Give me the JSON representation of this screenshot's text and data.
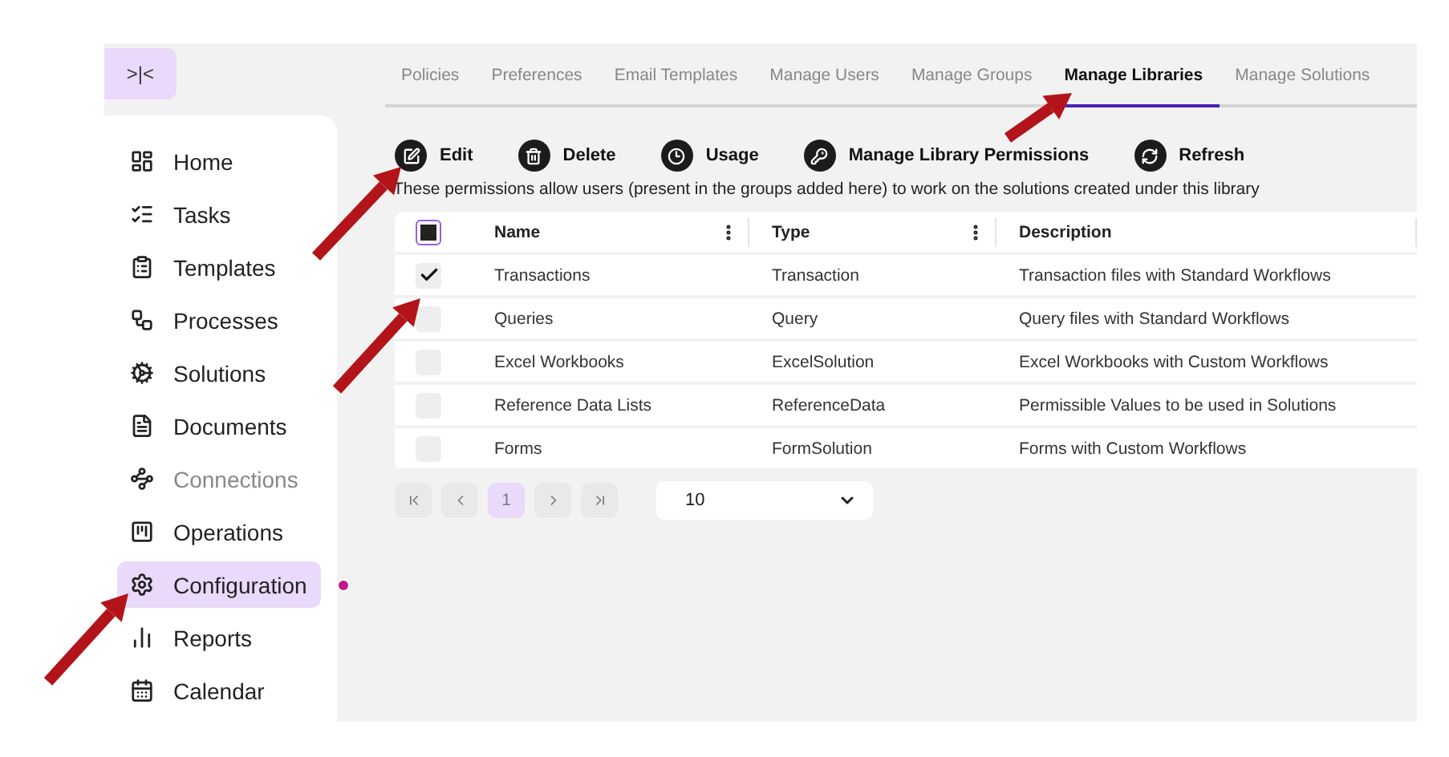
{
  "sidebar": {
    "toggle": ">|<",
    "items": [
      {
        "label": "Home",
        "selected": false,
        "disabled": false
      },
      {
        "label": "Tasks",
        "selected": false,
        "disabled": false
      },
      {
        "label": "Templates",
        "selected": false,
        "disabled": false
      },
      {
        "label": "Processes",
        "selected": false,
        "disabled": false
      },
      {
        "label": "Solutions",
        "selected": false,
        "disabled": false
      },
      {
        "label": "Documents",
        "selected": false,
        "disabled": false
      },
      {
        "label": "Connections",
        "selected": false,
        "disabled": true
      },
      {
        "label": "Operations",
        "selected": false,
        "disabled": false
      },
      {
        "label": "Configuration",
        "selected": true,
        "disabled": false
      },
      {
        "label": "Reports",
        "selected": false,
        "disabled": false
      },
      {
        "label": "Calendar",
        "selected": false,
        "disabled": false
      }
    ]
  },
  "tabs": [
    {
      "label": "Policies",
      "selected": false
    },
    {
      "label": "Preferences",
      "selected": false
    },
    {
      "label": "Email Templates",
      "selected": false
    },
    {
      "label": "Manage Users",
      "selected": false
    },
    {
      "label": "Manage Groups",
      "selected": false
    },
    {
      "label": "Manage Libraries",
      "selected": true
    },
    {
      "label": "Manage Solutions",
      "selected": false
    }
  ],
  "toolbar": [
    "Edit",
    "Delete",
    "Usage",
    "Manage Library Permissions",
    "Refresh"
  ],
  "description": "These permissions allow users (present in the groups added here) to work on the solutions created under this library",
  "table": {
    "all_checked": false,
    "columns": [
      "Name",
      "Type",
      "Description"
    ],
    "rows": [
      {
        "checked": true,
        "cells": [
          "Transactions",
          "Transaction",
          "Transaction files with Standard Workflows"
        ]
      },
      {
        "checked": false,
        "cells": [
          "Queries",
          "Query",
          "Query files with Standard Workflows"
        ]
      },
      {
        "checked": false,
        "cells": [
          "Excel Workbooks",
          "ExcelSolution",
          "Excel Workbooks with Custom Workflows"
        ]
      },
      {
        "checked": false,
        "cells": [
          "Reference Data Lists",
          "ReferenceData",
          "Permissible Values to be used in Solutions"
        ]
      },
      {
        "checked": false,
        "cells": [
          "Forms",
          "FormSolution",
          "Forms with Custom Workflows"
        ]
      }
    ]
  },
  "pagination": {
    "pages": [
      {
        "label": "1",
        "selected": true
      }
    ],
    "page_size": "10"
  }
}
